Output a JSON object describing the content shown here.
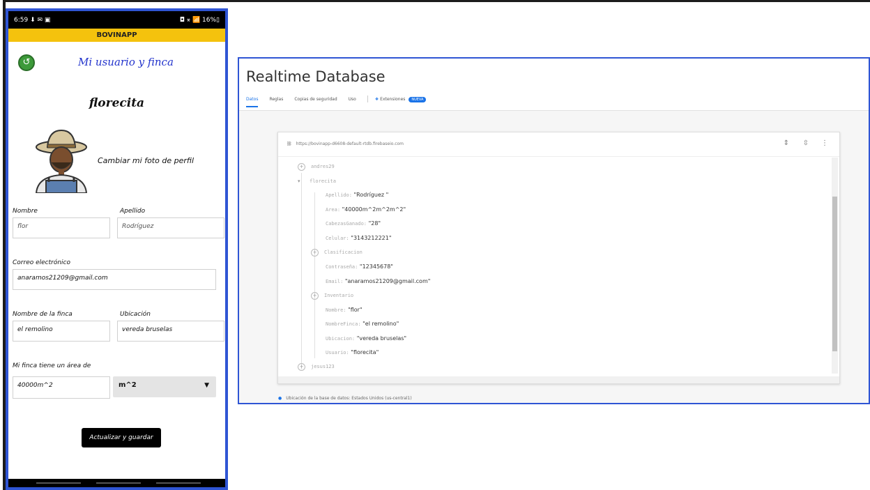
{
  "phone": {
    "status_time": "6:59 ⬇ ✉ ▣",
    "status_right": "◘ ⚹ 📶 16%▯",
    "app_name": "BOVINAPP",
    "back_icon": "back-arrow-icon",
    "screen_title": "Mi usuario y finca",
    "user_name": "florecita",
    "change_photo": "Cambiar mi foto de perfil",
    "labels": {
      "nombre": "Nombre",
      "apellido": "Apellido",
      "correo": "Correo electrónico",
      "nombre_finca": "Nombre de la finca",
      "ubicacion": "Ubicación",
      "area": "Mi finca tiene un área de"
    },
    "values": {
      "nombre": "flor",
      "apellido": "Rodríguez",
      "correo": "anaramos21209@gmail.com",
      "nombre_finca": "el remolino",
      "ubicacion": "vereda bruselas",
      "area": "40000m^2"
    },
    "unit_selected": "m^2",
    "save_button": "Actualizar y guardar"
  },
  "console": {
    "title": "Realtime Database",
    "tabs": [
      "Datos",
      "Reglas",
      "Copias de seguridad",
      "Uso"
    ],
    "extensions_tab": "Extensiones",
    "extensions_badge": "NUEVA",
    "url": "https://bovinapp-d6608-default-rtdb.firebaseio.com",
    "tree": {
      "node1": "andres29",
      "node2": "florecita",
      "fields": [
        {
          "key": "Apellido:",
          "value": "\"Rodríguez \""
        },
        {
          "key": "Area:",
          "value": "\"40000m^2m^2m^2\""
        },
        {
          "key": "CabezasGanado:",
          "value": "\"28\""
        },
        {
          "key": "Celular:",
          "value": "\"3143212221\""
        },
        {
          "key": "Clasificacion",
          "value": ""
        },
        {
          "key": "Contraseña:",
          "value": "\"12345678\""
        },
        {
          "key": "Email:",
          "value": "\"anaramos21209@gmail.com\""
        },
        {
          "key": "Inventario",
          "value": ""
        },
        {
          "key": "Nombre:",
          "value": "\"flor\""
        },
        {
          "key": "NombreFinca:",
          "value": "\"el remolino\""
        },
        {
          "key": "Ubicacion:",
          "value": "\"vereda bruselas\""
        },
        {
          "key": "Usuario:",
          "value": "\"florecita\""
        }
      ],
      "node3": "jesus123"
    },
    "location": "Ubicación de la base de datos: Estados Unidos (us-central1)"
  }
}
